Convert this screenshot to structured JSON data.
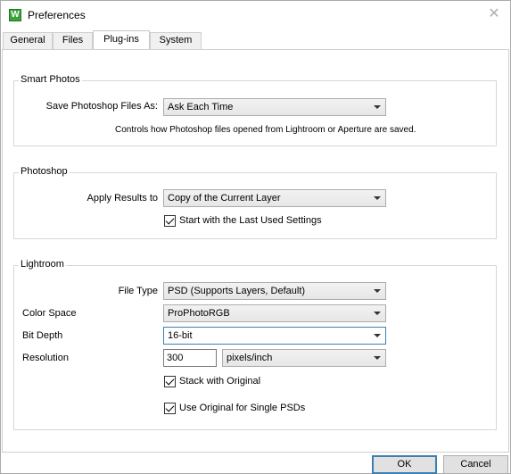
{
  "window": {
    "title": "Preferences",
    "icon": "lightroom-app-icon",
    "icon_glyph": "W",
    "close_glyph": "✕"
  },
  "tabs": [
    {
      "label": "General",
      "active": false
    },
    {
      "label": "Files",
      "active": false
    },
    {
      "label": "Plug-ins",
      "active": true
    },
    {
      "label": "System",
      "active": false
    }
  ],
  "smart_photos": {
    "title": "Smart Photos",
    "save_label": "Save Photoshop Files As:",
    "save_value": "Ask Each Time",
    "note": "Controls how Photoshop files opened from Lightroom or Aperture are saved."
  },
  "photoshop": {
    "title": "Photoshop",
    "apply_label": "Apply Results to",
    "apply_value": "Copy of the Current Layer",
    "last_settings_label": "Start with the Last Used Settings",
    "last_settings_checked": true
  },
  "lightroom": {
    "title": "Lightroom",
    "file_type_label": "File Type",
    "file_type_value": "PSD (Supports Layers, Default)",
    "color_space_label": "Color Space",
    "color_space_value": "ProPhotoRGB",
    "bit_depth_label": "Bit Depth",
    "bit_depth_value": "16-bit",
    "resolution_label": "Resolution",
    "resolution_value": "300",
    "resolution_unit": "pixels/inch",
    "stack_label": "Stack with Original",
    "stack_checked": true,
    "use_original_label": "Use Original for Single PSDs",
    "use_original_checked": true
  },
  "buttons": {
    "ok": "OK",
    "cancel": "Cancel"
  },
  "colors": {
    "accent": "#3c7fb1",
    "icon_green": "#3aa23a"
  }
}
